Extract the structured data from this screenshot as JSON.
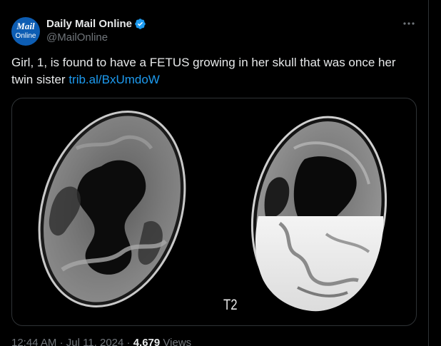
{
  "author": {
    "avatar_line1": "Mail",
    "avatar_line2": "Online",
    "display_name": "Daily Mail Online",
    "handle": "@MailOnline",
    "verified": true
  },
  "tweet": {
    "text": "Girl, 1, is found to have a FETUS growing in her skull that was once her twin sister",
    "link_text": "trib.al/BxUmdoW"
  },
  "media": {
    "label": "T2"
  },
  "meta": {
    "time": "12:44 AM",
    "separator": "·",
    "date": "Jul 11, 2024",
    "views_count": "4,679",
    "views_label": "Views"
  },
  "colors": {
    "background": "#000000",
    "text": "#e7e9ea",
    "secondary_text": "#71767b",
    "link": "#1d9bf0",
    "verified_badge": "#1d9bf0",
    "avatar_bg": "#0d5db3"
  },
  "icons": {
    "verified": "verified-badge-icon",
    "more": "more-options-icon"
  }
}
